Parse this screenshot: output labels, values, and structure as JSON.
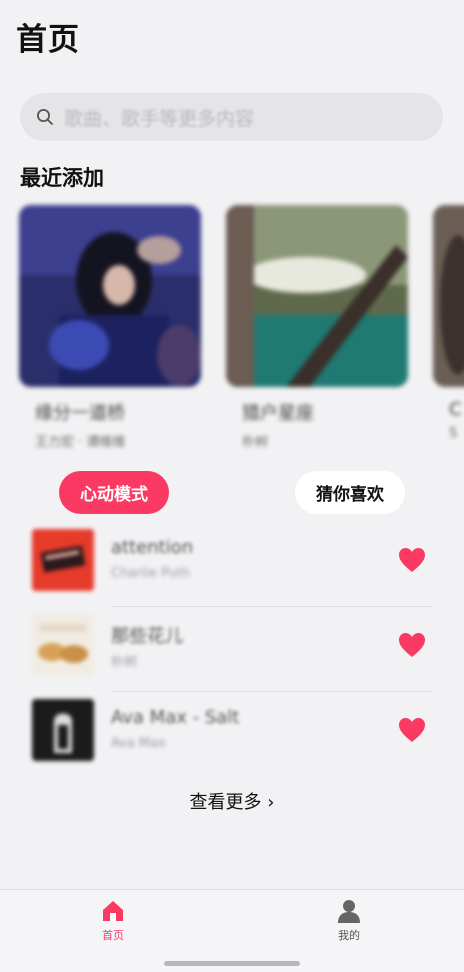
{
  "header": {
    "title": "首页"
  },
  "search": {
    "placeholder": "歌曲、歌手等更多内容"
  },
  "recent": {
    "title": "最近添加",
    "items": [
      {
        "title": "缘分一道桥",
        "subtitle": "王力宏 · 谭维维"
      },
      {
        "title": "猎户星座",
        "subtitle": "朴树"
      },
      {
        "title": "C",
        "subtitle": "S"
      }
    ]
  },
  "modes": {
    "active": "心动模式",
    "inactive": "猜你喜欢"
  },
  "songs": [
    {
      "name": "attention",
      "artist": "Charlie Puth"
    },
    {
      "name": "那些花儿",
      "artist": "朴树"
    },
    {
      "name": "Ava Max - Salt",
      "artist": "Ava Max"
    }
  ],
  "more": {
    "label": "查看更多 ›"
  },
  "tabbar": {
    "home": "首页",
    "mine": "我的"
  },
  "colors": {
    "accent": "#fb3a64",
    "background": "#f2f2f4"
  },
  "icons": {
    "search": "search-icon",
    "heart": "heart-icon",
    "home": "home-icon",
    "profile": "person-icon"
  }
}
